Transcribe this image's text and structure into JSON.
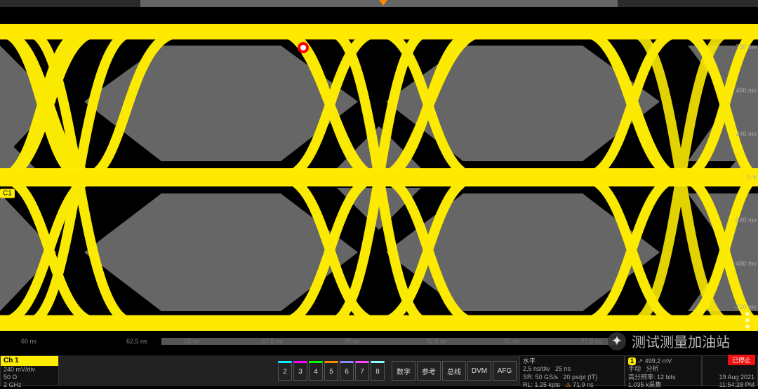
{
  "top": {
    "trig_marker": "T"
  },
  "y_axis": {
    "labels": [
      "",
      "720 mv",
      "480 mv",
      "240 mv",
      "0 V",
      "-240 mv",
      "-480 mv",
      "-720 mv",
      ""
    ]
  },
  "ch1_marker": "C1",
  "x_axis": {
    "t0": "60 ns",
    "t1": "62,5 ns",
    "ticks": [
      "65 ns",
      "67,5 ns",
      "70 ns",
      "72,5 ns",
      "75 ns",
      "77,5 ns"
    ]
  },
  "ch_readout": {
    "header": "Ch 1",
    "scale": "240 mV/div",
    "impedance": "50 Ω",
    "bandwidth": "2 GHz"
  },
  "ch_buttons": [
    "2",
    "3",
    "4",
    "5",
    "6",
    "7",
    "8"
  ],
  "mode_buttons": [
    "数字",
    "参考",
    "总线",
    "DVM",
    "AFG"
  ],
  "horizontal": {
    "title": "水平",
    "l1a": "2,5 ns/div",
    "l1b": "25 ns",
    "l2a": "SR: 50 GS/s",
    "l2b": "20 ps/pt (IT)",
    "l3a": "RL: 1.25 kpts",
    "l3b_icon": "⚠",
    "l3b": "71,9 ns"
  },
  "right1": {
    "ch_label": "1",
    "ch_icon": "↗",
    "level": "499,2 mV",
    "mode": "手动",
    "extra": "分析",
    "hires": "高分辨率: 12 bits",
    "samples": "1.035 k采集"
  },
  "right2": {
    "date": "19 Aug 2021",
    "time": "11:54:28 PM"
  },
  "stop_btn": "已停止",
  "watermark": "测试测量加油站"
}
